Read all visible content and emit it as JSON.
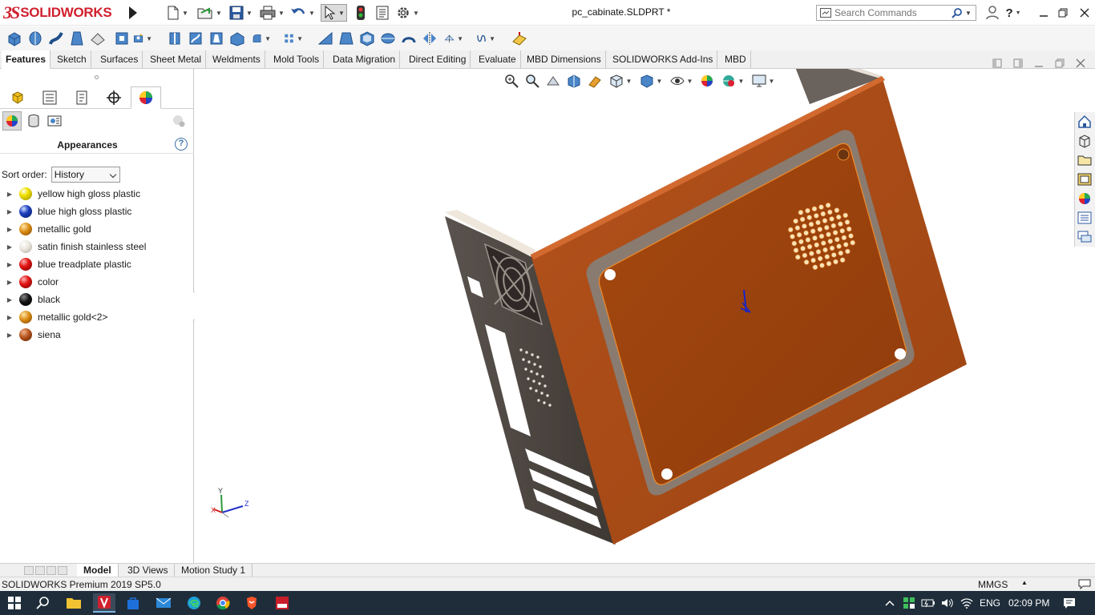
{
  "app": {
    "logo_prefix": "3S",
    "logo_text": "SOLIDWORKS",
    "document_title": "pc_cabinate.SLDPRT *"
  },
  "search": {
    "placeholder": "Search Commands"
  },
  "tabs": [
    {
      "label": "Features",
      "active": true
    },
    {
      "label": "Sketch"
    },
    {
      "label": "Surfaces"
    },
    {
      "label": "Sheet Metal"
    },
    {
      "label": "Weldments"
    },
    {
      "label": "Mold Tools"
    },
    {
      "label": "Data Migration"
    },
    {
      "label": "Direct Editing"
    },
    {
      "label": "Evaluate"
    },
    {
      "label": "MBD Dimensions"
    },
    {
      "label": "SOLIDWORKS Add-Ins"
    },
    {
      "label": "MBD"
    }
  ],
  "panel": {
    "title": "Appearances",
    "help_glyph": "?",
    "sort_label": "Sort order:",
    "sort_value": "History",
    "items": [
      {
        "label": "yellow high gloss plastic",
        "color": "#f2e200"
      },
      {
        "label": "blue high gloss plastic",
        "color": "#1d3fbf"
      },
      {
        "label": "metallic gold",
        "color": "#d98a12"
      },
      {
        "label": "satin finish stainless steel",
        "color": "#e9e4dc"
      },
      {
        "label": "blue treadplate plastic",
        "color": "#e31414"
      },
      {
        "label": "color",
        "color": "#e31414"
      },
      {
        "label": "black",
        "color": "#111111"
      },
      {
        "label": "metallic gold<2>",
        "color": "#d98a12"
      },
      {
        "label": "siena",
        "color": "#b4521c"
      }
    ]
  },
  "model": {
    "axis_y": "Y",
    "axis_x": "X",
    "axis_z": "Z"
  },
  "model_tabs": [
    {
      "label": "Model",
      "active": true
    },
    {
      "label": "3D Views"
    },
    {
      "label": "Motion Study 1"
    }
  ],
  "status": {
    "text": "SOLIDWORKS Premium 2019 SP5.0",
    "units": "MMGS",
    "units_caret": "▲"
  },
  "tray": {
    "language": "ENG",
    "time": "02:09 PM"
  },
  "colors": {
    "panel_face": "#b4521c",
    "panel_edge": "#8a3810",
    "metal": "#4a4440",
    "accent": "#d0202e"
  }
}
